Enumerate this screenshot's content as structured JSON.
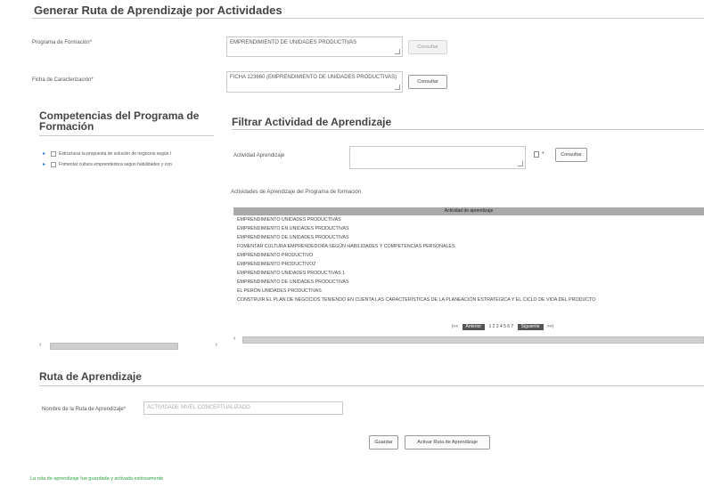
{
  "header": {
    "title": "Generar Ruta de Aprendizaje por Actividades"
  },
  "program": {
    "label": "Programa de Formación*",
    "value": "EMPRENDIMIENTO DE UNIDADES PRODUCTIVAS",
    "button": "Consultar"
  },
  "ficha": {
    "label": "Ficha de Caracterización*",
    "value": "FICHA 123660 (EMPRENDIMIENTO DE UNIDADES PRODUCTIVAS)",
    "button": "Consultar"
  },
  "competencias": {
    "title": "Competencias del Programa de Formación",
    "items": [
      "Estructurar la propuesta de solución de negocios según l",
      "Fomentar cultura emprendedora según habilidades y con"
    ]
  },
  "filtrar": {
    "title": "Filtrar Actividad de Aprendizaje",
    "label": "Actividad Aprendizaje",
    "value": "",
    "button": "Consultar",
    "star": "*"
  },
  "grid": {
    "caption": "Actividades de Aprendizaje del Programa de formación",
    "header": "Actividad de aprendizaje",
    "rows": [
      "EMPRENDIMIENTO UNIDADES PRODUCTIVAS",
      "EMPRENDIMIENTO EN UNIDADES PRODUCTIVAS",
      "EMPRENDIMIENTO DE UNIDADES PRODUCTIVAS",
      "FOMENTAR CULTURA EMPRENDEDORA SEGÚN HABILIDADES Y COMPETENCIAS PERSONALES",
      "EMPRENDIMIENTO PRODUCTIVO",
      "EMPRENDIMIENTO PRODUCTIVO2",
      "EMPRENDIMIENTO UNIDADES PRODUCTIVAS 1",
      "EMPRENDIMIENTO DE UNIDADES PRODUCTIVAS",
      "EL PERÓN UNIDADES PRODUCTIVAS",
      "CONSTRUIR EL PLAN DE NEGOCIOS TENIENDO EN CUENTA LAS CARACTERÍSTICAS DE LA PLANEACIÓN ESTRATÉGICA Y EL CICLO DE VIDA DEL PRODUCTO"
    ],
    "pager": {
      "first": "|<<",
      "prev": "Anterior",
      "pages": "1 2 3 4 5 6 7",
      "next": "Siguiente",
      "last": ">>|"
    }
  },
  "ruta": {
    "title": "Ruta de Aprendizaje",
    "label": "Nombre de la Ruta de Aprendizaje*",
    "placeholder": "ACTIVIDADE NIVEL CONCEPTUALIZADO"
  },
  "actions": {
    "save": "Guardar",
    "activate": "Activar Ruta de Aprendizaje"
  },
  "status": {
    "message": "La ruta de aprendizaje fue guardada y activada exitosamente"
  }
}
